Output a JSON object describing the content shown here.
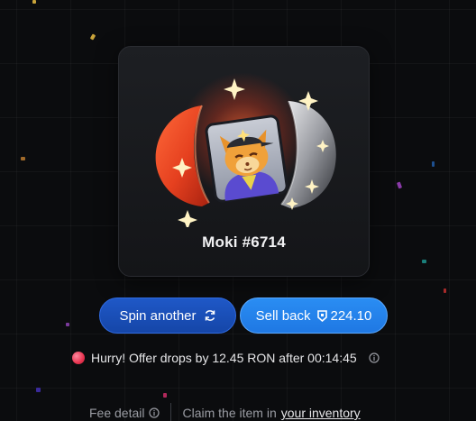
{
  "card": {
    "title": "Moki #6714"
  },
  "actions": {
    "spin_label": "Spin another",
    "sell_label": "Sell back",
    "sell_price": "224.10"
  },
  "offer": {
    "text": "Hurry! Offer drops by 12.45 RON after 00:14:45"
  },
  "footer": {
    "fee_label": "Fee detail",
    "claim_text": "Claim the item in",
    "inventory_link": "your inventory"
  },
  "colors": {
    "background": "#0b0c0e",
    "spin_button": "#1a4fb8",
    "sell_button": "#2487f0",
    "alert_dot": "#e8334f"
  },
  "icons": [
    "refresh-icon",
    "ron-token-icon",
    "info-icon",
    "alert-dot-icon"
  ]
}
